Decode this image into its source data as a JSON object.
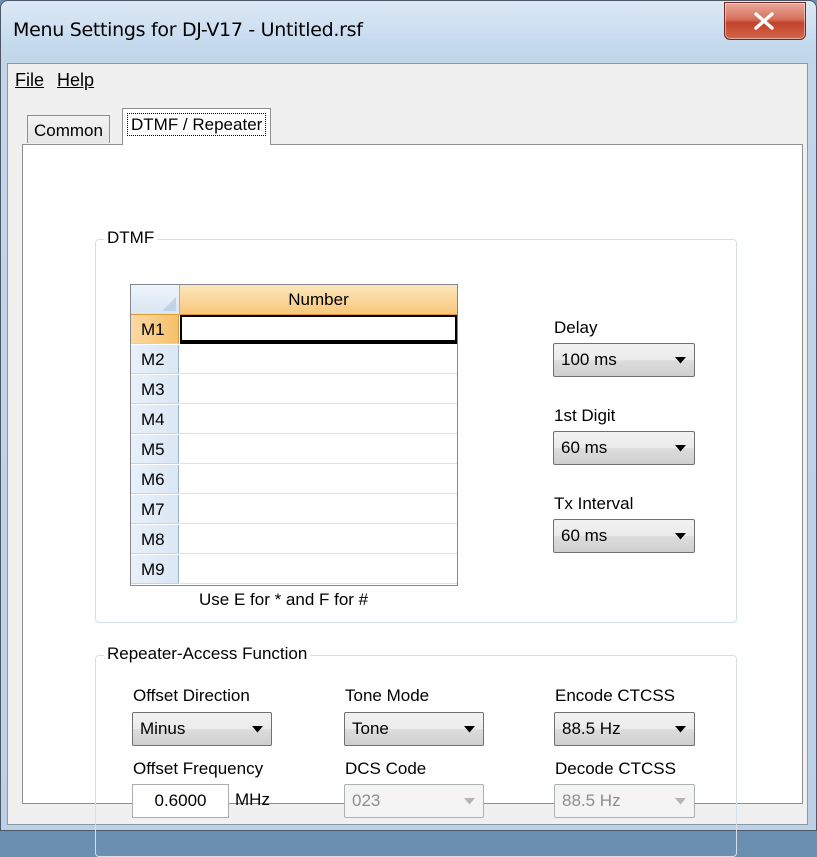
{
  "window": {
    "title": "Menu Settings for DJ-V17 - Untitled.rsf"
  },
  "menu": {
    "file": "File",
    "help": "Help"
  },
  "tabs": [
    {
      "label": "Common"
    },
    {
      "label": "DTMF / Repeater"
    }
  ],
  "dtmf": {
    "group_title": "DTMF",
    "grid": {
      "column_header": "Number",
      "rows": [
        {
          "label": "M1",
          "value": ""
        },
        {
          "label": "M2",
          "value": ""
        },
        {
          "label": "M3",
          "value": ""
        },
        {
          "label": "M4",
          "value": ""
        },
        {
          "label": "M5",
          "value": ""
        },
        {
          "label": "M6",
          "value": ""
        },
        {
          "label": "M7",
          "value": ""
        },
        {
          "label": "M8",
          "value": ""
        },
        {
          "label": "M9",
          "value": ""
        }
      ]
    },
    "hint": "Use E for * and F for #",
    "delay": {
      "label": "Delay",
      "value": "100 ms"
    },
    "first_digit": {
      "label": "1st Digit",
      "value": "60 ms"
    },
    "tx_interval": {
      "label": "Tx Interval",
      "value": "60 ms"
    }
  },
  "repeater": {
    "group_title": "Repeater-Access Function",
    "offset_direction": {
      "label": "Offset Direction",
      "value": "Minus"
    },
    "tone_mode": {
      "label": "Tone Mode",
      "value": "Tone"
    },
    "encode_ctcss": {
      "label": "Encode CTCSS",
      "value": "88.5 Hz"
    },
    "offset_frequency": {
      "label": "Offset Frequency",
      "value": "0.6000",
      "unit": "MHz"
    },
    "dcs_code": {
      "label": "DCS Code",
      "value": "023"
    },
    "decode_ctcss": {
      "label": "Decode CTCSS",
      "value": "88.5 Hz"
    }
  }
}
